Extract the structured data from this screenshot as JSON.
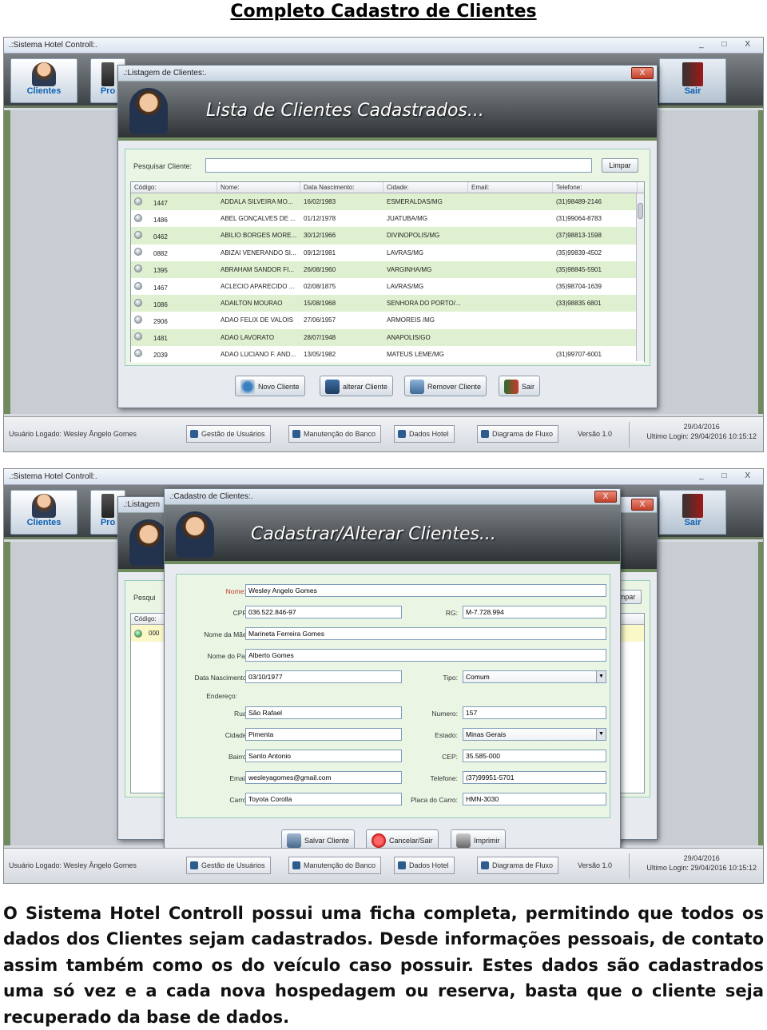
{
  "doc_title": "Completo Cadastro de Clientes",
  "app": {
    "title": ".:Sistema Hotel Controll:.",
    "toolbar": {
      "clientes": "Clientes",
      "produtos_partial": "Pro",
      "sair": "Sair"
    },
    "status": {
      "user": "Usuário Logado: Wesley Ângelo Gomes",
      "gestao": "Gestão de Usuários",
      "manutencao": "Manutenção do Banco",
      "dados_hotel": "Dados Hotel",
      "diagrama": "Diagrama de Fluxo",
      "versao": "Versão 1.0"
    },
    "status1": {
      "date": "29/04/2016",
      "login": "Ultimo Login: 29/04/2016 10:15:12"
    },
    "status2": {
      "date": "29/04/2016",
      "login": "Ultimo Login: 29/04/2016 10:15:12"
    }
  },
  "list_window": {
    "title": ".:Listagem de Clientes:.",
    "close": "X",
    "header": "Lista de Clientes Cadastrados...",
    "search_label": "Pesquisar Cliente:",
    "search_value": "",
    "limpar": "Limpar",
    "columns": [
      "Código:",
      "Nome:",
      "Data Nascimento:",
      "Cidade:",
      "Email:",
      "Telefone:"
    ],
    "rows": [
      {
        "codigo": "1447",
        "nome": "ADDALA SILVEIRA MO...",
        "nasc": "16/02/1983",
        "cidade": "ESMERALDAS/MG",
        "email": "",
        "tel": "(31)98489-2146"
      },
      {
        "codigo": "1486",
        "nome": "ABEL GONÇALVES DE ...",
        "nasc": "01/12/1978",
        "cidade": "JUATUBA/MG",
        "email": "",
        "tel": "(31)99064-8783"
      },
      {
        "codigo": "0462",
        "nome": "ABILIO BORGES MORE...",
        "nasc": "30/12/1966",
        "cidade": "DIVINOPOLIS/MG",
        "email": "",
        "tel": "(37)98813-1598"
      },
      {
        "codigo": "0882",
        "nome": "ABIZAI VENERANDO SI...",
        "nasc": "09/12/1981",
        "cidade": "LAVRAS/MG",
        "email": "",
        "tel": "(35)99839-4502"
      },
      {
        "codigo": "1395",
        "nome": "ABRAHAM SANDOR FI...",
        "nasc": "26/08/1960",
        "cidade": "VARGINHA/MG",
        "email": "",
        "tel": "(35)98845-5901"
      },
      {
        "codigo": "1467",
        "nome": "ACLECIO APARECIDO ...",
        "nasc": "02/08/1875",
        "cidade": "LAVRAS/MG",
        "email": "",
        "tel": "(35)98704-1639"
      },
      {
        "codigo": "1086",
        "nome": "ADAILTON MOURAO",
        "nasc": "15/08/1968",
        "cidade": "SENHORA DO PORTO/...",
        "email": "",
        "tel": "(33)98835 6801"
      },
      {
        "codigo": "2906",
        "nome": "ADAO FELIX DE VALOIS",
        "nasc": "27/06/1957",
        "cidade": "ARMOREIS /MG",
        "email": "",
        "tel": ""
      },
      {
        "codigo": "1481",
        "nome": "ADAO LAVORATO",
        "nasc": "28/07/1948",
        "cidade": "ANAPOLIS/GO",
        "email": "",
        "tel": ""
      },
      {
        "codigo": "2039",
        "nome": "ADAO LUCIANO F. AND...",
        "nasc": "13/05/1982",
        "cidade": "MATEUS LEME/MG",
        "email": "",
        "tel": "(31)99707-6001"
      }
    ],
    "buttons": {
      "novo": "Novo Cliente",
      "alterar": "alterar Cliente",
      "remover": "Remover Cliente",
      "sair": "Sair"
    }
  },
  "form_window": {
    "title": ".:Cadastro de Clientes:.",
    "behind_title": ".:Listagem",
    "close": "X",
    "header": "Cadastrar/Alterar Clientes...",
    "behind": {
      "pesquisar": "Pesqui",
      "codigo": "Código:",
      "row_code": "000",
      "limpar": "mpar"
    },
    "labels": {
      "nome": "Nome:*",
      "cpf": "CPF:",
      "rg": "RG:",
      "mae": "Nome da Mãe:",
      "pai": "Nome do Pai:",
      "nasc": "Data Nascimento:",
      "tipo": "Tipo:",
      "endereco": "Endereço:",
      "rua": "Rua:",
      "numero": "Numero:",
      "cidade": "Cidade:",
      "estado": "Estado:",
      "bairro": "Bairro:",
      "cep": "CEP:",
      "email": "Email:",
      "telefone": "Telefone:",
      "carro": "Carro:",
      "placa": "Placa do Carro:"
    },
    "values": {
      "nome": "Wesley Angelo Gomes",
      "cpf": "036.522.846-97",
      "rg": "M-7.728.994",
      "mae": "Marineta Ferreira Gomes",
      "pai": "Alberto Gomes",
      "nasc": "03/10/1977",
      "tipo": "Comum",
      "rua": "São Rafael",
      "numero": "157",
      "cidade": "Pimenta",
      "estado": "Minas Gerais",
      "bairro": "Santo Antonio",
      "cep": "35.585-000",
      "email": "wesleyagomes@gmail.com",
      "telefone": "(37)99951-5701",
      "carro": "Toyota Corolla",
      "placa": "HMN-3030"
    },
    "buttons": {
      "salvar": "Salvar Cliente",
      "cancelar": "Cancelar/Sair",
      "imprimir": "Imprimir"
    }
  },
  "description": "O Sistema Hotel Controll possui uma ficha completa, permitindo que todos os dados dos Clientes sejam cadastrados. Desde informações pessoais, de contato assim também como os do veículo caso possuir. Estes dados são cadastrados uma só vez e a cada nova hospedagem ou reserva, basta que o cliente seja recuperado da base de dados.",
  "colors": {
    "green_accent": "#6f8a5c",
    "row_green": "#dff0d0",
    "panel_green": "#eaf5e4",
    "link_blue": "#0c5fb3"
  }
}
